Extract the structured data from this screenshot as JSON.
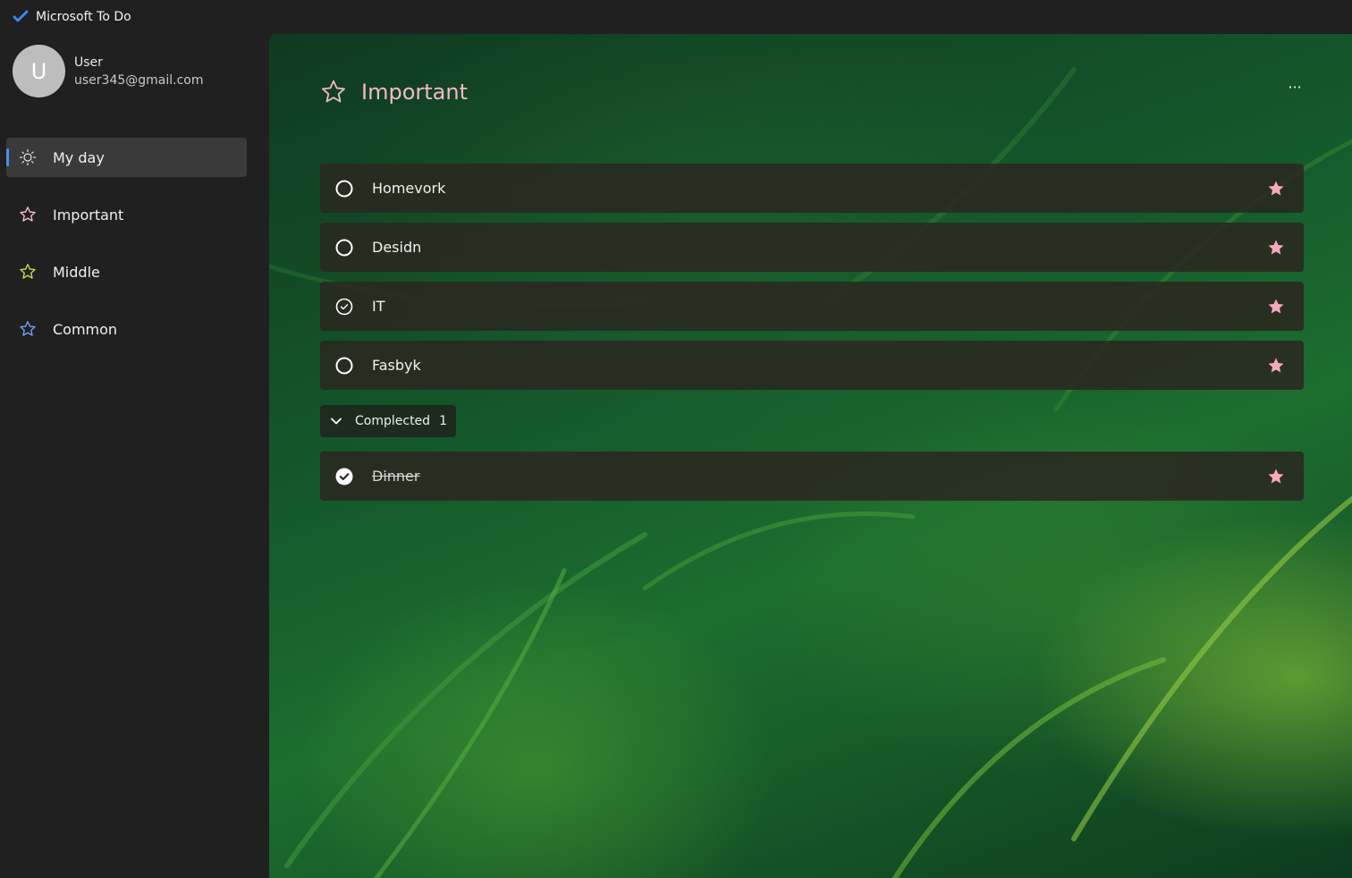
{
  "app": {
    "title": "Microsoft To Do"
  },
  "account": {
    "initial": "U",
    "name": "User",
    "email": "user345@gmail.com"
  },
  "sidebar": {
    "items": [
      {
        "label": "My day",
        "icon": "sun-icon",
        "active": true
      },
      {
        "label": "Important",
        "icon": "star-outline-icon",
        "color": "#f3b9c9"
      },
      {
        "label": "Middle",
        "icon": "star-outline-icon",
        "color": "#c9d84a"
      },
      {
        "label": "Common",
        "icon": "star-outline-icon",
        "color": "#6f9ff6"
      }
    ]
  },
  "main": {
    "title": "Important",
    "title_color": "#f3b9c9",
    "more_label": "···",
    "tasks": [
      {
        "title": "Homevork",
        "state": "open",
        "starred": true
      },
      {
        "title": "Desidn",
        "state": "open",
        "starred": true
      },
      {
        "title": "IT",
        "state": "hover-check",
        "starred": true
      },
      {
        "title": "Fasbyk",
        "state": "open",
        "starred": true
      }
    ],
    "completed": {
      "label": "Complected",
      "count": "1",
      "tasks": [
        {
          "title": "Dinner",
          "state": "done",
          "starred": true
        }
      ]
    }
  },
  "colors": {
    "accent": "#4c8df6",
    "star": "#f6a8bd",
    "sidebar_bg": "#202020"
  }
}
